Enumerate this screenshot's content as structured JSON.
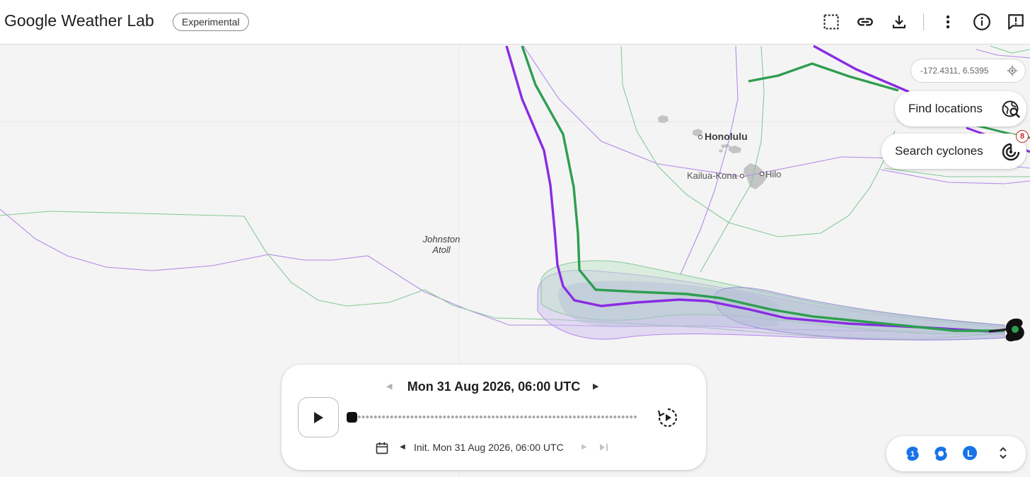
{
  "header": {
    "title": "Google Weather Lab",
    "badge": "Experimental",
    "icons": [
      "select-area-icon",
      "link-icon",
      "download-icon",
      "more-vert-icon",
      "info-icon",
      "feedback-icon"
    ]
  },
  "map": {
    "coordinates": "-172.4311, 6.5395",
    "labels": {
      "honolulu": "Honolulu",
      "kailua_kona": "Kailua-Kona",
      "hilo": "Hilo",
      "johnston_line1": "Johnston",
      "johnston_line2": "Atoll"
    },
    "colors": {
      "ensemble_purple": "#b48ae8",
      "ensemble_green": "#86c998",
      "mean_purple": "#8a2be2",
      "mean_green": "#2e9e4f",
      "land": "#c4c4c4",
      "background": "#f4f4f4"
    }
  },
  "controls": {
    "find_locations": "Find locations",
    "search_cyclones": "Search cyclones",
    "cyclone_count": "8"
  },
  "timeline": {
    "current_time": "Mon 31 Aug 2026, 06:00 UTC",
    "init_time": "Init. Mon 31 Aug 2026, 06:00 UTC",
    "progress": 0
  },
  "legend": {
    "items": [
      "cyclone-category-1-icon",
      "tropical-storm-icon",
      "low-pressure-icon"
    ],
    "category_label": "1",
    "low_label": "L"
  }
}
